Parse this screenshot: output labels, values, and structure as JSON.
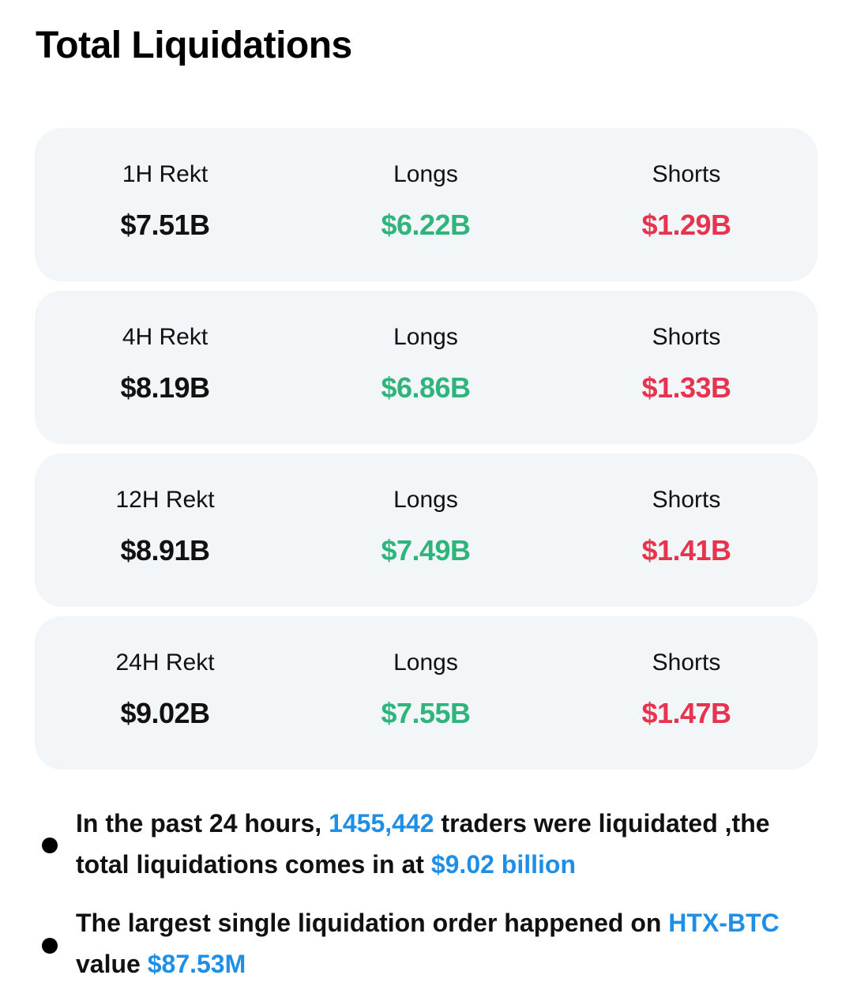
{
  "title": "Total Liquidations",
  "colors": {
    "longs": "#2fb47c",
    "shorts": "#e8334f",
    "highlight": "#1e8ee6",
    "card_bg": "#f2f6f9"
  },
  "cards": [
    {
      "period_label": "1H Rekt",
      "total": "$7.51B",
      "longs_label": "Longs",
      "longs": "$6.22B",
      "shorts_label": "Shorts",
      "shorts": "$1.29B"
    },
    {
      "period_label": "4H Rekt",
      "total": "$8.19B",
      "longs_label": "Longs",
      "longs": "$6.86B",
      "shorts_label": "Shorts",
      "shorts": "$1.33B"
    },
    {
      "period_label": "12H Rekt",
      "total": "$8.91B",
      "longs_label": "Longs",
      "longs": "$7.49B",
      "shorts_label": "Shorts",
      "shorts": "$1.41B"
    },
    {
      "period_label": "24H Rekt",
      "total": "$9.02B",
      "longs_label": "Longs",
      "longs": "$7.55B",
      "shorts_label": "Shorts",
      "shorts": "$1.47B"
    }
  ],
  "notes": {
    "n1": {
      "text1": "In the past 24 hours, ",
      "traders": "1455,442",
      "text2": " traders were liquidated ,the total liquidations comes in at ",
      "amount": "$9.02 billion"
    },
    "n2": {
      "text1": "The largest single liquidation order happened on ",
      "pair": "HTX-BTC",
      "text2": " value ",
      "amount": "$87.53M"
    }
  }
}
